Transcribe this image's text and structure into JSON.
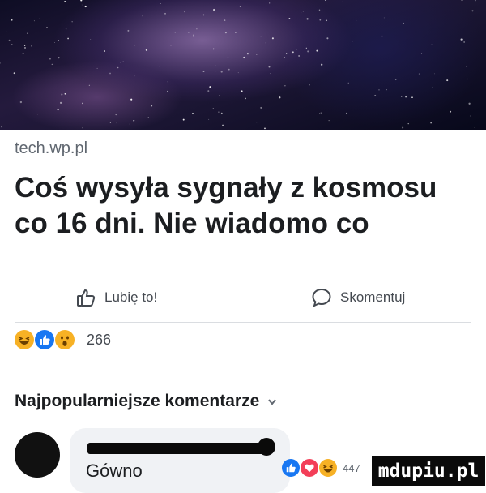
{
  "post": {
    "source": "tech.wp.pl",
    "headline": "Coś wysyła sygnały z kosmosu co 16 dni. Nie wiadomo co"
  },
  "actions": {
    "like_label": "Lubię to!",
    "comment_label": "Skomentuj"
  },
  "reactions": {
    "icons": [
      "haha-icon",
      "like-icon",
      "wow-icon"
    ],
    "count": "266"
  },
  "comments": {
    "sort_label": "Najpopularniejsze komentarze",
    "items": [
      {
        "text": "Gówno",
        "reactions": [
          "like-icon",
          "love-icon",
          "haha-icon"
        ],
        "reaction_count": "447"
      }
    ]
  },
  "watermark": "mdupiu.pl",
  "colors": {
    "like_blue": "#1877f2",
    "love_red": "#f33e58",
    "emoji_yellow": "#f7b125",
    "text_primary": "#1c1e21",
    "text_secondary": "#606770"
  }
}
